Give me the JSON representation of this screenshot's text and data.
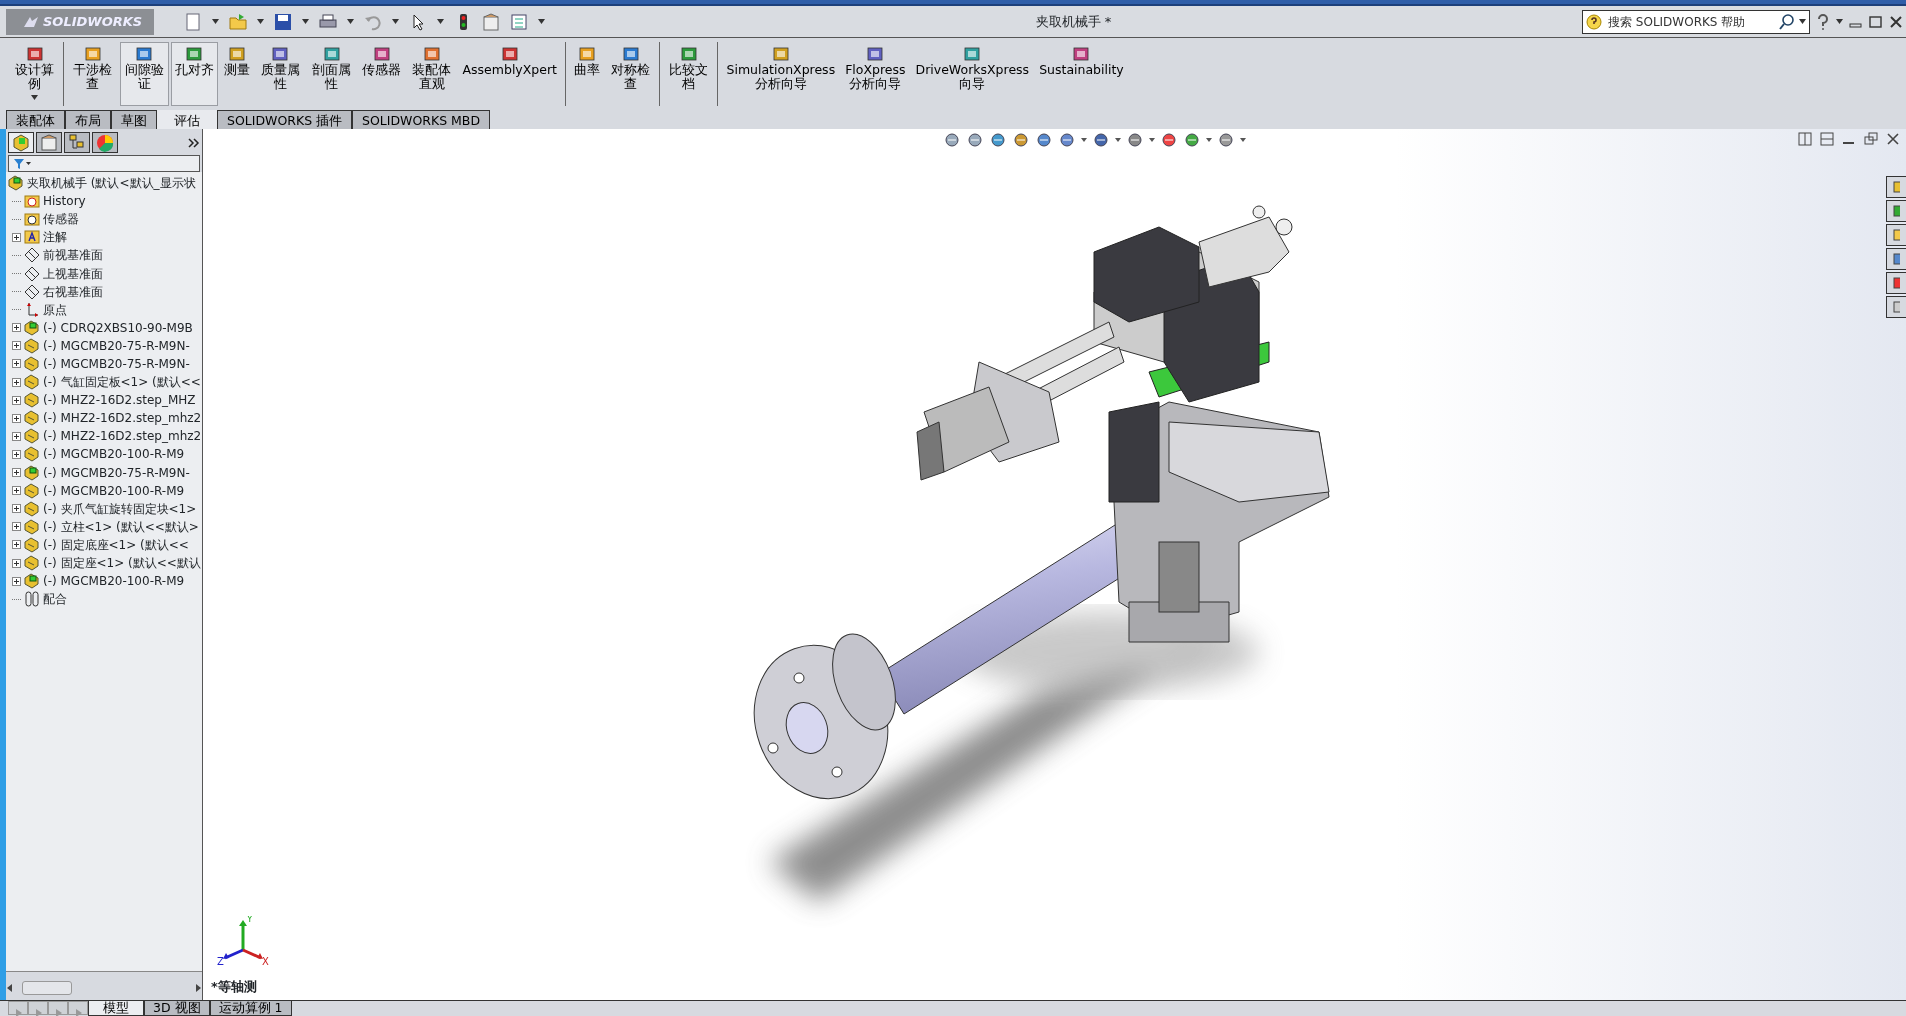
{
  "window": {
    "title": "夹取机械手 *"
  },
  "app_logo": {
    "text": "SOLIDWORKS"
  },
  "search": {
    "placeholder": "搜索 SOLIDWORKS 帮助"
  },
  "command_groups": [
    [
      {
        "label": "设计算例",
        "pressed": false,
        "dropdown": true
      }
    ],
    [
      {
        "label": "干涉检查",
        "pressed": false
      },
      {
        "label": "间隙验证",
        "pressed": true
      },
      {
        "label": "孔对齐",
        "pressed": true
      },
      {
        "label": "测量",
        "pressed": false
      },
      {
        "label": "质量属性",
        "pressed": false
      },
      {
        "label": "剖面属性",
        "pressed": false
      },
      {
        "label": "传感器",
        "pressed": false
      },
      {
        "label": "装配体直观",
        "pressed": false
      },
      {
        "label": "AssemblyXpert",
        "pressed": false
      }
    ],
    [
      {
        "label": "曲率",
        "pressed": false
      },
      {
        "label": "对称检查",
        "pressed": false
      }
    ],
    [
      {
        "label": "比较文档",
        "pressed": false
      }
    ],
    [
      {
        "label": "SimulationXpress 分析向导",
        "pressed": false
      },
      {
        "label": "FloXpress 分析向导",
        "pressed": false
      },
      {
        "label": "DriveWorksXpress 向导",
        "pressed": false
      },
      {
        "label": "Sustainability",
        "pressed": false
      }
    ]
  ],
  "tabs": [
    {
      "label": "装配体",
      "selected": false
    },
    {
      "label": "布局",
      "selected": false
    },
    {
      "label": "草图",
      "selected": false
    },
    {
      "label": "评估",
      "selected": true
    },
    {
      "label": "SOLIDWORKS 插件",
      "selected": false
    },
    {
      "label": "SOLIDWORKS MBD",
      "selected": false
    }
  ],
  "panel_tabs": [
    {
      "selected": true
    },
    {
      "selected": false
    },
    {
      "selected": false
    },
    {
      "selected": false
    }
  ],
  "feature_tree": {
    "items": [
      {
        "label": "夹取机械手 (默认<默认_显示状",
        "kind": "assembly",
        "expandable": false,
        "children": [
          {
            "label": "History",
            "kind": "history",
            "expandable": false
          },
          {
            "label": "传感器",
            "kind": "sensors",
            "expandable": false
          },
          {
            "label": "注解",
            "kind": "annotations",
            "expandable": true
          },
          {
            "label": "前视基准面",
            "kind": "plane",
            "expandable": false
          },
          {
            "label": "上视基准面",
            "kind": "plane",
            "expandable": false
          },
          {
            "label": "右视基准面",
            "kind": "plane",
            "expandable": false
          },
          {
            "label": "原点",
            "kind": "origin",
            "expandable": false
          },
          {
            "label": "(-) CDRQ2XBS10-90-M9B",
            "kind": "assembly",
            "expandable": true
          },
          {
            "label": "(-) MGCMB20-75-R-M9N-",
            "kind": "part",
            "expandable": true
          },
          {
            "label": "(-) MGCMB20-75-R-M9N-",
            "kind": "part",
            "expandable": true
          },
          {
            "label": "(-) 气缸固定板<1> (默认<<",
            "kind": "part",
            "expandable": true
          },
          {
            "label": "(-) MHZ2-16D2.step_MHZ",
            "kind": "part",
            "expandable": true
          },
          {
            "label": "(-) MHZ2-16D2.step_mhz2",
            "kind": "part",
            "expandable": true
          },
          {
            "label": "(-) MHZ2-16D2.step_mhz2",
            "kind": "part",
            "expandable": true
          },
          {
            "label": "(-) MGCMB20-100-R-M9",
            "kind": "part",
            "expandable": true
          },
          {
            "label": "(-) MGCMB20-75-R-M9N-",
            "kind": "assembly",
            "expandable": true
          },
          {
            "label": "(-) MGCMB20-100-R-M9",
            "kind": "part",
            "expandable": true
          },
          {
            "label": "(-) 夹爪气缸旋转固定块<1>",
            "kind": "part",
            "expandable": true
          },
          {
            "label": "(-) 立柱<1> (默认<<默认>",
            "kind": "part",
            "expandable": true
          },
          {
            "label": "(-) 固定底座<1> (默认<<",
            "kind": "part",
            "expandable": true
          },
          {
            "label": "(-) 固定座<1> (默认<<默认",
            "kind": "part",
            "expandable": true
          },
          {
            "label": "(-) MGCMB20-100-R-M9",
            "kind": "assembly",
            "expandable": true
          },
          {
            "label": "配合",
            "kind": "mates",
            "expandable": false
          }
        ]
      }
    ]
  },
  "viewport": {
    "view_label": "*等轴测",
    "triad": {
      "x": "X",
      "y": "Y",
      "z": "Z"
    }
  },
  "bottom_tabs": [
    {
      "label": "模型",
      "selected": true
    },
    {
      "label": "3D 视图",
      "selected": false
    },
    {
      "label": "运动算例 1",
      "selected": false
    }
  ]
}
